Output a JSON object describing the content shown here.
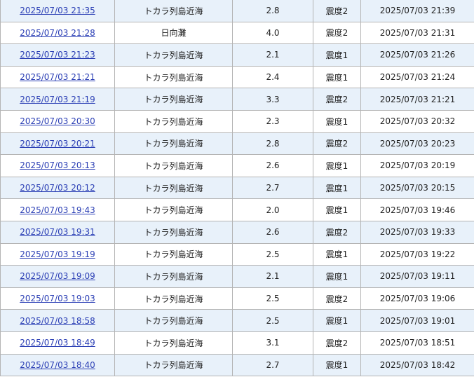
{
  "rows": [
    {
      "time": "2025/07/03 21:35",
      "place": "トカラ列島近海",
      "magnitude": "2.8",
      "intensity": "震度2",
      "published": "2025/07/03 21:39"
    },
    {
      "time": "2025/07/03 21:28",
      "place": "日向灘",
      "magnitude": "4.0",
      "intensity": "震度2",
      "published": "2025/07/03 21:31"
    },
    {
      "time": "2025/07/03 21:23",
      "place": "トカラ列島近海",
      "magnitude": "2.1",
      "intensity": "震度1",
      "published": "2025/07/03 21:26"
    },
    {
      "time": "2025/07/03 21:21",
      "place": "トカラ列島近海",
      "magnitude": "2.4",
      "intensity": "震度1",
      "published": "2025/07/03 21:24"
    },
    {
      "time": "2025/07/03 21:19",
      "place": "トカラ列島近海",
      "magnitude": "3.3",
      "intensity": "震度2",
      "published": "2025/07/03 21:21"
    },
    {
      "time": "2025/07/03 20:30",
      "place": "トカラ列島近海",
      "magnitude": "2.3",
      "intensity": "震度1",
      "published": "2025/07/03 20:32"
    },
    {
      "time": "2025/07/03 20:21",
      "place": "トカラ列島近海",
      "magnitude": "2.8",
      "intensity": "震度2",
      "published": "2025/07/03 20:23"
    },
    {
      "time": "2025/07/03 20:13",
      "place": "トカラ列島近海",
      "magnitude": "2.6",
      "intensity": "震度1",
      "published": "2025/07/03 20:19"
    },
    {
      "time": "2025/07/03 20:12",
      "place": "トカラ列島近海",
      "magnitude": "2.7",
      "intensity": "震度1",
      "published": "2025/07/03 20:15"
    },
    {
      "time": "2025/07/03 19:43",
      "place": "トカラ列島近海",
      "magnitude": "2.0",
      "intensity": "震度1",
      "published": "2025/07/03 19:46"
    },
    {
      "time": "2025/07/03 19:31",
      "place": "トカラ列島近海",
      "magnitude": "2.6",
      "intensity": "震度2",
      "published": "2025/07/03 19:33"
    },
    {
      "time": "2025/07/03 19:19",
      "place": "トカラ列島近海",
      "magnitude": "2.5",
      "intensity": "震度1",
      "published": "2025/07/03 19:22"
    },
    {
      "time": "2025/07/03 19:09",
      "place": "トカラ列島近海",
      "magnitude": "2.1",
      "intensity": "震度1",
      "published": "2025/07/03 19:11"
    },
    {
      "time": "2025/07/03 19:03",
      "place": "トカラ列島近海",
      "magnitude": "2.5",
      "intensity": "震度2",
      "published": "2025/07/03 19:06"
    },
    {
      "time": "2025/07/03 18:58",
      "place": "トカラ列島近海",
      "magnitude": "2.5",
      "intensity": "震度1",
      "published": "2025/07/03 19:01"
    },
    {
      "time": "2025/07/03 18:49",
      "place": "トカラ列島近海",
      "magnitude": "3.1",
      "intensity": "震度2",
      "published": "2025/07/03 18:51"
    },
    {
      "time": "2025/07/03 18:40",
      "place": "トカラ列島近海",
      "magnitude": "2.7",
      "intensity": "震度1",
      "published": "2025/07/03 18:42"
    }
  ],
  "colors": {
    "row_stripe": "#e8f1fa",
    "row_plain": "#ffffff",
    "link": "#2b3fb5",
    "border": "#b4b4b4"
  }
}
